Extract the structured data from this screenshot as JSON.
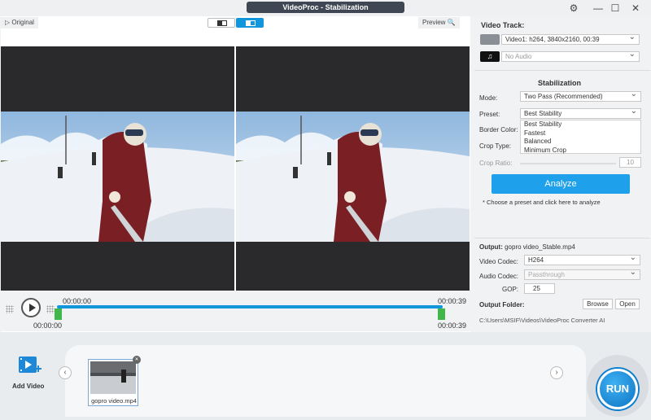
{
  "window": {
    "title": "VideoProc - Stabilization",
    "settings_glyph": "⚙",
    "minimize_glyph": "—",
    "maximize_glyph": "☐",
    "close_glyph": "✕"
  },
  "preview": {
    "original_label": "▷ Original",
    "preview_label": "Preview 🔍",
    "time_current": "00:00:00",
    "time_end": "00:00:39",
    "time_start_bottom": "00:00:00",
    "time_end_bottom": "00:00:39"
  },
  "panel": {
    "video_track_label": "Video Track:",
    "video_track_value": "Video1: h264, 3840x2160, 00:39",
    "audio_track_value": "No Audio",
    "stabilization_heading": "Stabilization",
    "mode_label": "Mode:",
    "mode_value": "Two Pass (Recommended)",
    "preset_label": "Preset:",
    "preset_value": "Best Stability",
    "preset_options": [
      "Best Stability",
      "Fastest",
      "Balanced",
      "Minimum Crop"
    ],
    "border_color_label": "Border Color:",
    "crop_type_label": "Crop Type:",
    "crop_ratio_label": "Crop Ratio:",
    "crop_ratio_value": "10",
    "analyze_label": "Analyze",
    "analyze_hint": "* Choose a preset and click here to analyze",
    "output_label": "Output:",
    "output_file": "gopro video_Stable.mp4",
    "video_codec_label": "Video Codec:",
    "video_codec_value": "H264",
    "audio_codec_label": "Audio Codec:",
    "audio_codec_value": "Passthrough",
    "gop_label": "GOP:",
    "gop_value": "25",
    "output_folder_label": "Output Folder:",
    "browse_label": "Browse",
    "open_label": "Open",
    "output_path": "C:\\Users\\MSIF\\Videos\\VideoProc Converter AI"
  },
  "bottom": {
    "add_video_label": "Add Video",
    "clip_name": "gopro video.mp4",
    "run_label": "RUN",
    "left_arrow": "‹",
    "right_arrow": "›",
    "clip_close": "✕"
  },
  "colors": {
    "accent": "#1296db",
    "handle": "#41b649",
    "title_bg": "#3f4754"
  }
}
